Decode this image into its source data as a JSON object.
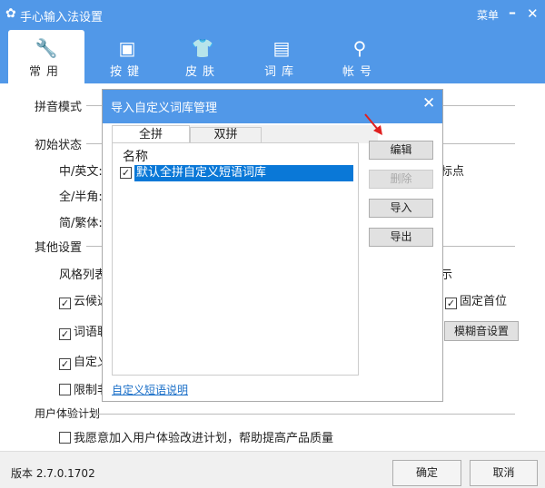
{
  "window": {
    "title": "手心输入法设置",
    "menu": "菜单",
    "minimize": "–",
    "close": "✕",
    "gear": "✿"
  },
  "tabs": [
    {
      "label": "常用",
      "icon": "🔧"
    },
    {
      "label": "按键",
      "icon": "▣"
    },
    {
      "label": "皮肤",
      "icon": "👕"
    },
    {
      "label": "词库",
      "icon": "▤"
    },
    {
      "label": "帐号",
      "icon": "⚲"
    }
  ],
  "main": {
    "pinyin_mode": "拼音模式",
    "initial_state": "初始状态",
    "cn_en": "中/英文:",
    "punct_partial": "标点",
    "full_half": "全/半角:",
    "simp_trad": "简/繁体:",
    "other": "其他设置",
    "style_list": "风格列表",
    "show_partial": "示",
    "cloud": "云候选",
    "fixed_first": "固定首位",
    "word_assoc": "词语联",
    "fuzzy_button": "模糊音设置",
    "custom": "自定义",
    "limit": "限制非",
    "ux_plan": "用户体验计划",
    "ux_join": "我愿意加入用户体验改进计划，帮助提高产品质量"
  },
  "footer": {
    "version": "版本 2.7.0.1702",
    "ok": "确定",
    "cancel": "取消"
  },
  "dialog": {
    "title": "导入自定义词库管理",
    "close": "✕",
    "tabs": [
      "全拼",
      "双拼"
    ],
    "column": "名称",
    "items": [
      {
        "name": "默认全拼自定义短语词库",
        "checked": true
      }
    ],
    "buttons": {
      "edit": "编辑",
      "delete": "删除",
      "import": "导入",
      "export": "导出"
    },
    "link": "自定义短语说明"
  }
}
